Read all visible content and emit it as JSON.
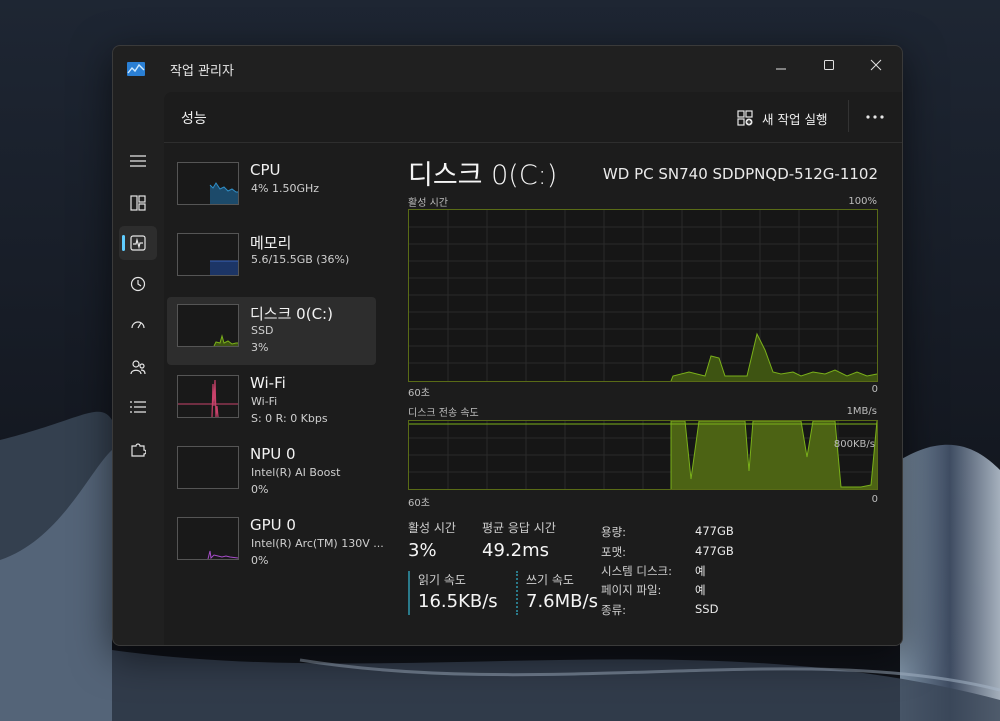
{
  "window": {
    "title": "작업 관리자"
  },
  "header": {
    "title": "성능",
    "run_task_label": "새 작업 실행"
  },
  "devices": [
    {
      "name": "CPU",
      "sub1": "4% 1.50GHz",
      "sub2": "",
      "color": "#2f8fc9"
    },
    {
      "name": "메모리",
      "sub1": "5.6/15.5GB (36%)",
      "sub2": "",
      "color": "#3a63b8"
    },
    {
      "name": "디스크 0(C:)",
      "sub1": "SSD",
      "sub2": "3%",
      "color": "#7ab01a"
    },
    {
      "name": "Wi-Fi",
      "sub1": "Wi-Fi",
      "sub2": "S: 0 R: 0 Kbps",
      "color": "#c8426a"
    },
    {
      "name": "NPU 0",
      "sub1": "Intel(R) AI Boost",
      "sub2": "0%",
      "color": "#2fa39d"
    },
    {
      "name": "GPU 0",
      "sub1": "Intel(R) Arc(TM) 130V ...",
      "sub2": "0%",
      "color": "#a64dc9"
    }
  ],
  "detail": {
    "title": "디스크 0(C:)",
    "model": "WD PC SN740 SDDPNQD-512G-1102",
    "graph1": {
      "label": "활성 시간",
      "max": "100%",
      "left": "60초",
      "right": "0"
    },
    "graph2": {
      "label": "디스크 전송 속도",
      "max": "1MB/s",
      "mark": "800KB/s",
      "left": "60초",
      "right": "0"
    },
    "stats": {
      "active_label": "활성 시간",
      "active_value": "3%",
      "resp_label": "평균 응답 시간",
      "resp_value": "49.2ms",
      "read_label": "읽기 속도",
      "read_value": "16.5KB/s",
      "write_label": "쓰기 속도",
      "write_value": "7.6MB/s"
    },
    "props": [
      {
        "k": "용량:",
        "v": "477GB"
      },
      {
        "k": "포맷:",
        "v": "477GB"
      },
      {
        "k": "시스템 디스크:",
        "v": "예"
      },
      {
        "k": "페이지 파일:",
        "v": "예"
      },
      {
        "k": "종류:",
        "v": "SSD"
      }
    ]
  },
  "colors": {
    "accent": "#60cdff",
    "disk": "#7ab01a",
    "disk_fill": "#4c6314"
  }
}
